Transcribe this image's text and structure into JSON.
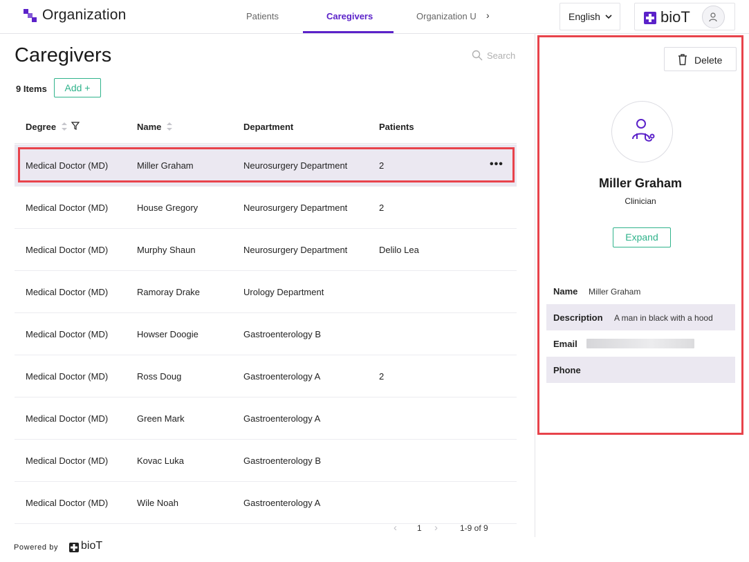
{
  "header": {
    "app_title": "Organization",
    "tabs": [
      {
        "label": "Patients",
        "active": false
      },
      {
        "label": "Caregivers",
        "active": true
      },
      {
        "label": "Organization U:",
        "active": false
      }
    ],
    "language": "English",
    "brand_name": "bioT"
  },
  "page": {
    "title": "Caregivers",
    "items_count": "9 Items",
    "add_label": "Add +",
    "search_placeholder": "Search"
  },
  "table": {
    "columns": [
      "Degree",
      "Name",
      "Department",
      "Patients"
    ],
    "rows": [
      {
        "degree": "Medical Doctor (MD)",
        "name": "Miller Graham",
        "department": "Neurosurgery Department",
        "patients": "2",
        "selected": true
      },
      {
        "degree": "Medical Doctor (MD)",
        "name": "House Gregory",
        "department": "Neurosurgery Department",
        "patients": "2"
      },
      {
        "degree": "Medical Doctor (MD)",
        "name": "Murphy Shaun",
        "department": "Neurosurgery Department",
        "patients": "Delilo Lea"
      },
      {
        "degree": "Medical Doctor (MD)",
        "name": "Ramoray Drake",
        "department": "Urology Department",
        "patients": ""
      },
      {
        "degree": "Medical Doctor (MD)",
        "name": "Howser Doogie",
        "department": "Gastroenterology B",
        "patients": ""
      },
      {
        "degree": "Medical Doctor (MD)",
        "name": "Ross Doug",
        "department": "Gastroenterology A",
        "patients": "2"
      },
      {
        "degree": "Medical Doctor (MD)",
        "name": "Green Mark",
        "department": "Gastroenterology A",
        "patients": ""
      },
      {
        "degree": "Medical Doctor (MD)",
        "name": "Kovac Luka",
        "department": "Gastroenterology B",
        "patients": ""
      },
      {
        "degree": "Medical Doctor (MD)",
        "name": "Wile Noah",
        "department": "Gastroenterology A",
        "patients": ""
      }
    ],
    "row_menu": "•••"
  },
  "pagination": {
    "current_page": "1",
    "range": "1-9 of 9",
    "prev": "‹",
    "next": "›"
  },
  "footer": {
    "powered_by": "Powered by",
    "brand_name": "bioT"
  },
  "detail": {
    "delete_label": "Delete",
    "name": "Miller Graham",
    "role": "Clinician",
    "expand_label": "Expand",
    "fields": [
      {
        "label": "Name",
        "value": "Miller Graham"
      },
      {
        "label": "Description",
        "value": "A man in black with a hood"
      },
      {
        "label": "Email",
        "value": ""
      },
      {
        "label": "Phone",
        "value": ""
      }
    ]
  },
  "colors": {
    "accent": "#5b22c9",
    "action_green": "#2fb38b",
    "highlight_red": "#e8434b",
    "selected_row": "#ebe8f1"
  }
}
